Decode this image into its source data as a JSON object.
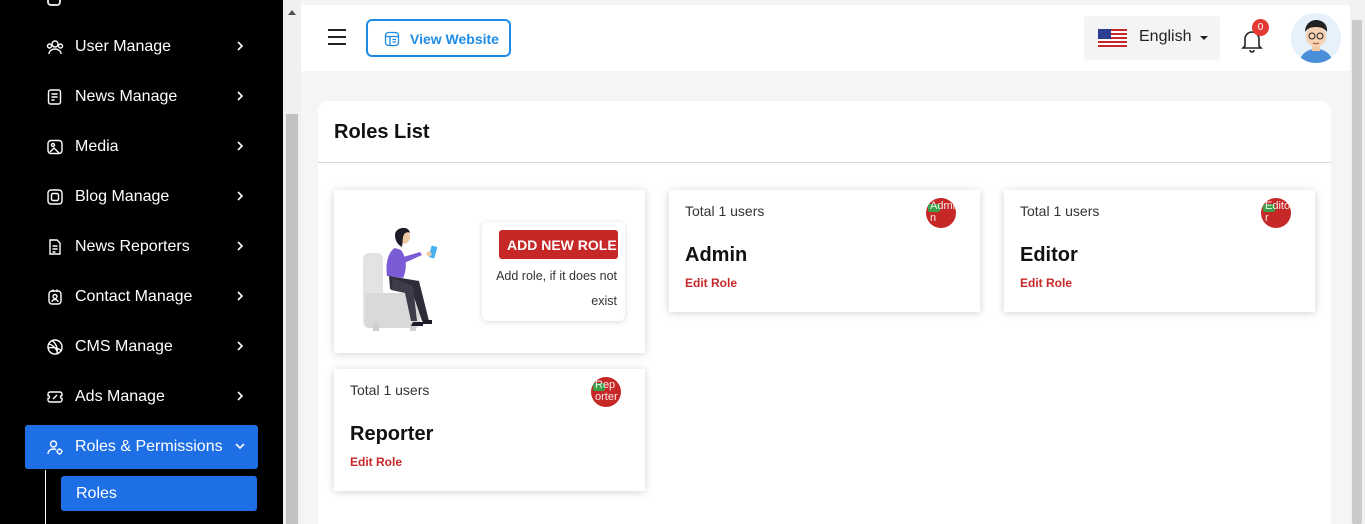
{
  "sidebar": {
    "items": [
      {
        "label": "User Manage"
      },
      {
        "label": "News Manage"
      },
      {
        "label": "Media"
      },
      {
        "label": "Blog Manage"
      },
      {
        "label": "News Reporters"
      },
      {
        "label": "Contact Manage"
      },
      {
        "label": "CMS Manage"
      },
      {
        "label": "Ads Manage"
      },
      {
        "label": "Roles & Permissions",
        "active": true
      }
    ],
    "sub_items": [
      {
        "label": "Roles",
        "active": true
      }
    ]
  },
  "header": {
    "view_website_label": "View Website",
    "language": "English",
    "notification_count": "0"
  },
  "page": {
    "title": "Roles List"
  },
  "add_role_card": {
    "button_label": "ADD NEW ROLE",
    "note": "Add role, if it does not exist"
  },
  "roles": [
    {
      "users_text": "Total 1 users",
      "name": "Admin",
      "edit_label": "Edit Role",
      "image_alt": "Admin"
    },
    {
      "users_text": "Total 1 users",
      "name": "Editor",
      "edit_label": "Edit Role",
      "image_alt": "Editor"
    },
    {
      "users_text": "Total 1 users",
      "name": "Reporter",
      "edit_label": "Edit Role",
      "image_alt": "Reporter"
    }
  ],
  "colors": {
    "sidebar_bg": "#000000",
    "accent_blue": "#1e6fe6",
    "brand_red": "#c62828"
  },
  "icons": {
    "sidebar": [
      "users-icon",
      "news-icon",
      "media-icon",
      "blog-icon",
      "reporter-icon",
      "contact-icon",
      "cms-icon",
      "ads-icon",
      "roles-icon"
    ]
  }
}
